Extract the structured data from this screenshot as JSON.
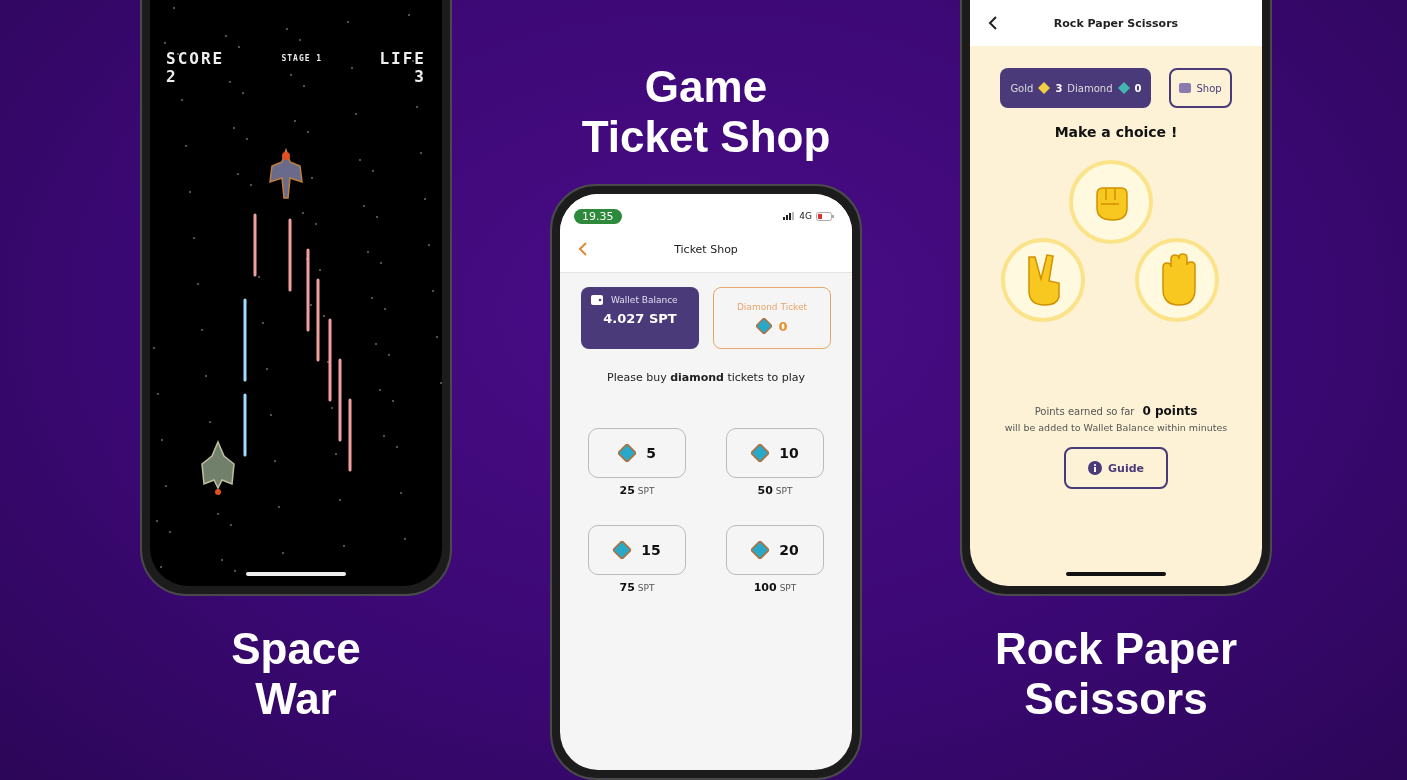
{
  "panels": [
    {
      "kind": "space_war",
      "caption_lines": [
        "Space",
        "War"
      ],
      "hud": {
        "score_label": "SCORE",
        "score": "2",
        "stage": "STAGE 1",
        "life_label": "LIFE",
        "life": "3"
      }
    },
    {
      "kind": "ticket_shop",
      "caption_lines": [
        "Game",
        "Ticket Shop"
      ],
      "status": {
        "time": "19.35",
        "network": "4G"
      },
      "title": "Ticket Shop",
      "wallet": {
        "label": "Wallet Balance",
        "value": "4.027 SPT"
      },
      "ticket": {
        "label": "Diamond Ticket",
        "count": "0"
      },
      "message": "Please buy **diamond** tickets to play",
      "packages": [
        {
          "count": "5",
          "price": "25",
          "unit": "SPT"
        },
        {
          "count": "10",
          "price": "50",
          "unit": "SPT"
        },
        {
          "count": "15",
          "price": "75",
          "unit": "SPT"
        },
        {
          "count": "20",
          "price": "100",
          "unit": "SPT"
        }
      ]
    },
    {
      "kind": "rock_paper_scissors",
      "caption_lines": [
        "Rock Paper",
        "Scissors"
      ],
      "title": "Rock Paper Scissors",
      "balance": {
        "gold_label": "Gold",
        "gold": "3",
        "diamond_label": "Diamond",
        "diamond": "0"
      },
      "shop": "Shop",
      "prompt": "Make a choice !",
      "choices": [
        {
          "kind": "rock"
        },
        {
          "kind": "scissors"
        },
        {
          "kind": "paper"
        }
      ],
      "points_label": "Points earned so far",
      "points": "0 points",
      "note": "will be added to Wallet Balance within minutes",
      "guide": "Guide"
    }
  ]
}
